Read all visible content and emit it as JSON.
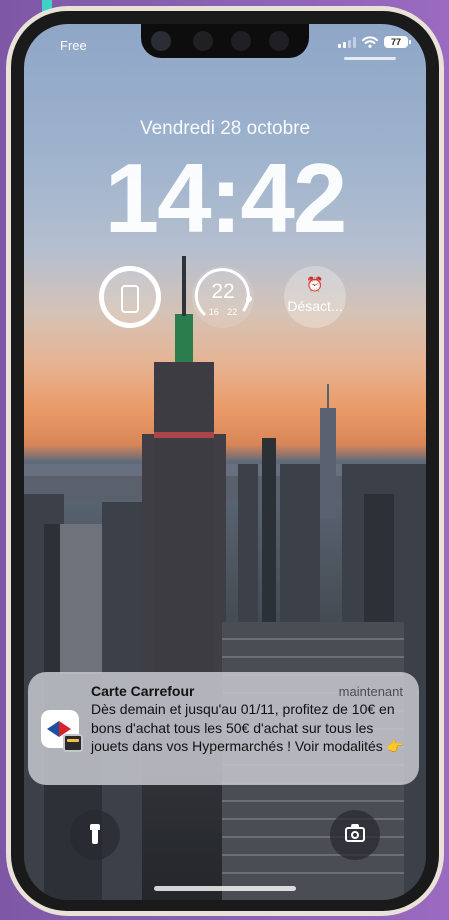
{
  "status_bar": {
    "carrier": "Free",
    "battery": "77"
  },
  "lock_screen": {
    "date": "Vendredi 28 octobre",
    "time": "14:42"
  },
  "widgets": {
    "temperature": {
      "current": "22",
      "range": "16 22"
    },
    "alarm": {
      "label": "Désact..."
    }
  },
  "notification": {
    "app": "Carte Carrefour",
    "time": "maintenant",
    "body": "Dès demain et jusqu'au 01/11, profitez de 10€ en bons d'achat tous les 50€ d'achat sur tous les jouets dans vos Hypermarchés ! Voir modalités 👉"
  },
  "icons": {
    "flashlight": "flashlight-icon",
    "camera": "camera-icon",
    "wifi": "wifi-icon",
    "signal": "signal-icon",
    "battery": "battery-icon",
    "alarm": "alarm-clock-icon",
    "phone": "phone-icon",
    "app": "carrefour-icon"
  }
}
